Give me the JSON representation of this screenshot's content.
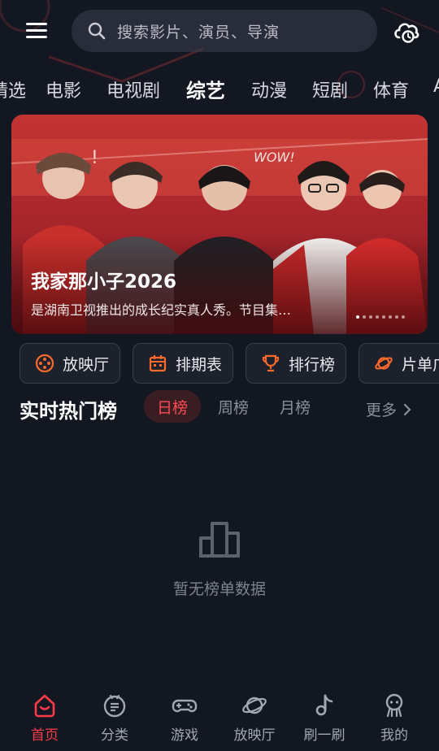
{
  "search": {
    "placeholder": "搜索影片、演员、导演"
  },
  "tabs": [
    {
      "label": "精选"
    },
    {
      "label": "电影"
    },
    {
      "label": "电视剧"
    },
    {
      "label": "综艺",
      "active": true
    },
    {
      "label": "动漫"
    },
    {
      "label": "短剧"
    },
    {
      "label": "体育"
    },
    {
      "label": "A"
    }
  ],
  "banner": {
    "title": "我家那小子2026",
    "description": "是湖南卫视推出的成长纪实真人秀。节目集…",
    "slide_count": 8,
    "active_slide": 1
  },
  "quick_actions": [
    {
      "label": "放映厅",
      "icon": "film-reel-icon"
    },
    {
      "label": "排期表",
      "icon": "calendar-icon"
    },
    {
      "label": "排行榜",
      "icon": "trophy-icon"
    },
    {
      "label": "片单广",
      "icon": "planet-icon"
    }
  ],
  "hot_list": {
    "title": "实时热门榜",
    "periods": [
      {
        "label": "日榜",
        "active": true
      },
      {
        "label": "周榜"
      },
      {
        "label": "月榜"
      }
    ],
    "more_label": "更多",
    "empty_text": "暂无榜单数据"
  },
  "bottom_nav": [
    {
      "label": "首页",
      "icon": "home-icon",
      "active": true
    },
    {
      "label": "分类",
      "icon": "category-icon"
    },
    {
      "label": "游戏",
      "icon": "gamepad-icon"
    },
    {
      "label": "放映厅",
      "icon": "planet-icon"
    },
    {
      "label": "刷一刷",
      "icon": "music-note-icon"
    },
    {
      "label": "我的",
      "icon": "profile-icon"
    }
  ],
  "colors": {
    "background": "#131722",
    "accent": "#ff3b47",
    "quick_icon": "#ff6a2b"
  }
}
